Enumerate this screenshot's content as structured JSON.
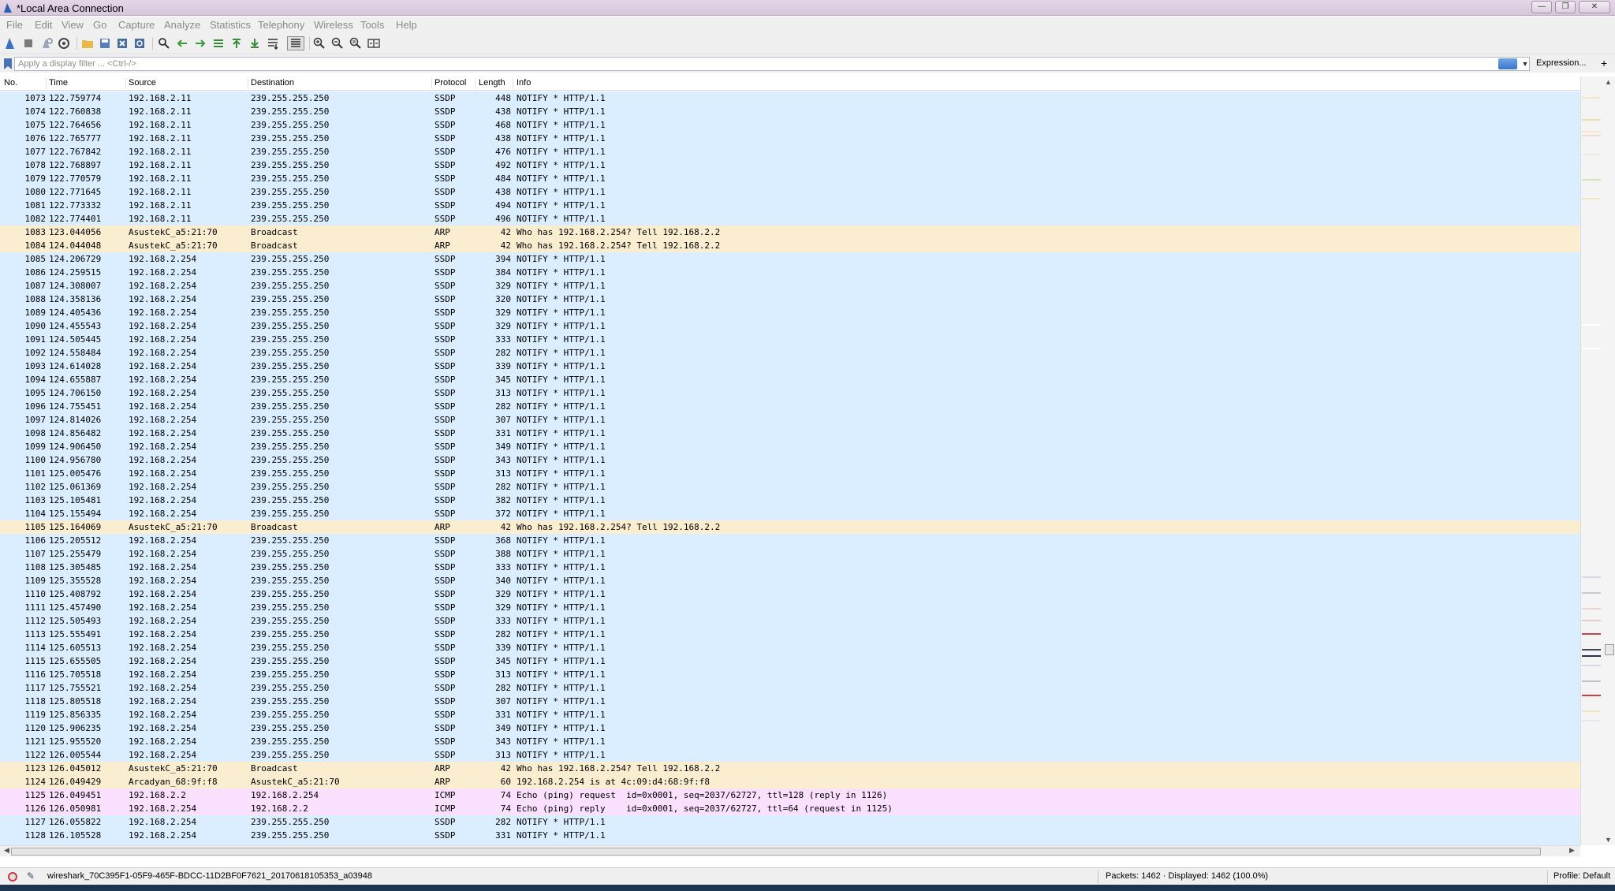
{
  "window": {
    "title": "*Local Area Connection"
  },
  "menu": [
    "File",
    "Edit",
    "View",
    "Go",
    "Capture",
    "Analyze",
    "Statistics",
    "Telephony",
    "Wireless",
    "Tools",
    "Help"
  ],
  "filter": {
    "placeholder": "Apply a display filter ... <Ctrl-/>",
    "expression_label": "Expression...",
    "add_label": "+"
  },
  "columns": {
    "no": "No.",
    "time": "Time",
    "source": "Source",
    "destination": "Destination",
    "protocol": "Protocol",
    "length": "Length",
    "info": "Info"
  },
  "packets": [
    {
      "no": "1073",
      "time": "122.759774",
      "src": "192.168.2.11",
      "dst": "239.255.255.250",
      "proto": "SSDP",
      "len": "448",
      "info": "NOTIFY * HTTP/1.1"
    },
    {
      "no": "1074",
      "time": "122.760838",
      "src": "192.168.2.11",
      "dst": "239.255.255.250",
      "proto": "SSDP",
      "len": "438",
      "info": "NOTIFY * HTTP/1.1"
    },
    {
      "no": "1075",
      "time": "122.764656",
      "src": "192.168.2.11",
      "dst": "239.255.255.250",
      "proto": "SSDP",
      "len": "468",
      "info": "NOTIFY * HTTP/1.1"
    },
    {
      "no": "1076",
      "time": "122.765777",
      "src": "192.168.2.11",
      "dst": "239.255.255.250",
      "proto": "SSDP",
      "len": "438",
      "info": "NOTIFY * HTTP/1.1"
    },
    {
      "no": "1077",
      "time": "122.767842",
      "src": "192.168.2.11",
      "dst": "239.255.255.250",
      "proto": "SSDP",
      "len": "476",
      "info": "NOTIFY * HTTP/1.1"
    },
    {
      "no": "1078",
      "time": "122.768897",
      "src": "192.168.2.11",
      "dst": "239.255.255.250",
      "proto": "SSDP",
      "len": "492",
      "info": "NOTIFY * HTTP/1.1"
    },
    {
      "no": "1079",
      "time": "122.770579",
      "src": "192.168.2.11",
      "dst": "239.255.255.250",
      "proto": "SSDP",
      "len": "484",
      "info": "NOTIFY * HTTP/1.1"
    },
    {
      "no": "1080",
      "time": "122.771645",
      "src": "192.168.2.11",
      "dst": "239.255.255.250",
      "proto": "SSDP",
      "len": "438",
      "info": "NOTIFY * HTTP/1.1"
    },
    {
      "no": "1081",
      "time": "122.773332",
      "src": "192.168.2.11",
      "dst": "239.255.255.250",
      "proto": "SSDP",
      "len": "494",
      "info": "NOTIFY * HTTP/1.1"
    },
    {
      "no": "1082",
      "time": "122.774401",
      "src": "192.168.2.11",
      "dst": "239.255.255.250",
      "proto": "SSDP",
      "len": "496",
      "info": "NOTIFY * HTTP/1.1"
    },
    {
      "no": "1083",
      "time": "123.044056",
      "src": "AsustekC_a5:21:70",
      "dst": "Broadcast",
      "proto": "ARP",
      "len": "42",
      "info": "Who has 192.168.2.254? Tell 192.168.2.2"
    },
    {
      "no": "1084",
      "time": "124.044048",
      "src": "AsustekC_a5:21:70",
      "dst": "Broadcast",
      "proto": "ARP",
      "len": "42",
      "info": "Who has 192.168.2.254? Tell 192.168.2.2"
    },
    {
      "no": "1085",
      "time": "124.206729",
      "src": "192.168.2.254",
      "dst": "239.255.255.250",
      "proto": "SSDP",
      "len": "394",
      "info": "NOTIFY * HTTP/1.1"
    },
    {
      "no": "1086",
      "time": "124.259515",
      "src": "192.168.2.254",
      "dst": "239.255.255.250",
      "proto": "SSDP",
      "len": "384",
      "info": "NOTIFY * HTTP/1.1"
    },
    {
      "no": "1087",
      "time": "124.308007",
      "src": "192.168.2.254",
      "dst": "239.255.255.250",
      "proto": "SSDP",
      "len": "329",
      "info": "NOTIFY * HTTP/1.1"
    },
    {
      "no": "1088",
      "time": "124.358136",
      "src": "192.168.2.254",
      "dst": "239.255.255.250",
      "proto": "SSDP",
      "len": "320",
      "info": "NOTIFY * HTTP/1.1"
    },
    {
      "no": "1089",
      "time": "124.405436",
      "src": "192.168.2.254",
      "dst": "239.255.255.250",
      "proto": "SSDP",
      "len": "329",
      "info": "NOTIFY * HTTP/1.1"
    },
    {
      "no": "1090",
      "time": "124.455543",
      "src": "192.168.2.254",
      "dst": "239.255.255.250",
      "proto": "SSDP",
      "len": "329",
      "info": "NOTIFY * HTTP/1.1"
    },
    {
      "no": "1091",
      "time": "124.505445",
      "src": "192.168.2.254",
      "dst": "239.255.255.250",
      "proto": "SSDP",
      "len": "333",
      "info": "NOTIFY * HTTP/1.1"
    },
    {
      "no": "1092",
      "time": "124.558484",
      "src": "192.168.2.254",
      "dst": "239.255.255.250",
      "proto": "SSDP",
      "len": "282",
      "info": "NOTIFY * HTTP/1.1"
    },
    {
      "no": "1093",
      "time": "124.614028",
      "src": "192.168.2.254",
      "dst": "239.255.255.250",
      "proto": "SSDP",
      "len": "339",
      "info": "NOTIFY * HTTP/1.1"
    },
    {
      "no": "1094",
      "time": "124.655887",
      "src": "192.168.2.254",
      "dst": "239.255.255.250",
      "proto": "SSDP",
      "len": "345",
      "info": "NOTIFY * HTTP/1.1"
    },
    {
      "no": "1095",
      "time": "124.706150",
      "src": "192.168.2.254",
      "dst": "239.255.255.250",
      "proto": "SSDP",
      "len": "313",
      "info": "NOTIFY * HTTP/1.1"
    },
    {
      "no": "1096",
      "time": "124.755451",
      "src": "192.168.2.254",
      "dst": "239.255.255.250",
      "proto": "SSDP",
      "len": "282",
      "info": "NOTIFY * HTTP/1.1"
    },
    {
      "no": "1097",
      "time": "124.814026",
      "src": "192.168.2.254",
      "dst": "239.255.255.250",
      "proto": "SSDP",
      "len": "307",
      "info": "NOTIFY * HTTP/1.1"
    },
    {
      "no": "1098",
      "time": "124.856482",
      "src": "192.168.2.254",
      "dst": "239.255.255.250",
      "proto": "SSDP",
      "len": "331",
      "info": "NOTIFY * HTTP/1.1"
    },
    {
      "no": "1099",
      "time": "124.906450",
      "src": "192.168.2.254",
      "dst": "239.255.255.250",
      "proto": "SSDP",
      "len": "349",
      "info": "NOTIFY * HTTP/1.1"
    },
    {
      "no": "1100",
      "time": "124.956780",
      "src": "192.168.2.254",
      "dst": "239.255.255.250",
      "proto": "SSDP",
      "len": "343",
      "info": "NOTIFY * HTTP/1.1"
    },
    {
      "no": "1101",
      "time": "125.005476",
      "src": "192.168.2.254",
      "dst": "239.255.255.250",
      "proto": "SSDP",
      "len": "313",
      "info": "NOTIFY * HTTP/1.1"
    },
    {
      "no": "1102",
      "time": "125.061369",
      "src": "192.168.2.254",
      "dst": "239.255.255.250",
      "proto": "SSDP",
      "len": "282",
      "info": "NOTIFY * HTTP/1.1"
    },
    {
      "no": "1103",
      "time": "125.105481",
      "src": "192.168.2.254",
      "dst": "239.255.255.250",
      "proto": "SSDP",
      "len": "382",
      "info": "NOTIFY * HTTP/1.1"
    },
    {
      "no": "1104",
      "time": "125.155494",
      "src": "192.168.2.254",
      "dst": "239.255.255.250",
      "proto": "SSDP",
      "len": "372",
      "info": "NOTIFY * HTTP/1.1"
    },
    {
      "no": "1105",
      "time": "125.164069",
      "src": "AsustekC_a5:21:70",
      "dst": "Broadcast",
      "proto": "ARP",
      "len": "42",
      "info": "Who has 192.168.2.254? Tell 192.168.2.2"
    },
    {
      "no": "1106",
      "time": "125.205512",
      "src": "192.168.2.254",
      "dst": "239.255.255.250",
      "proto": "SSDP",
      "len": "368",
      "info": "NOTIFY * HTTP/1.1"
    },
    {
      "no": "1107",
      "time": "125.255479",
      "src": "192.168.2.254",
      "dst": "239.255.255.250",
      "proto": "SSDP",
      "len": "388",
      "info": "NOTIFY * HTTP/1.1"
    },
    {
      "no": "1108",
      "time": "125.305485",
      "src": "192.168.2.254",
      "dst": "239.255.255.250",
      "proto": "SSDP",
      "len": "333",
      "info": "NOTIFY * HTTP/1.1"
    },
    {
      "no": "1109",
      "time": "125.355528",
      "src": "192.168.2.254",
      "dst": "239.255.255.250",
      "proto": "SSDP",
      "len": "340",
      "info": "NOTIFY * HTTP/1.1"
    },
    {
      "no": "1110",
      "time": "125.408792",
      "src": "192.168.2.254",
      "dst": "239.255.255.250",
      "proto": "SSDP",
      "len": "329",
      "info": "NOTIFY * HTTP/1.1"
    },
    {
      "no": "1111",
      "time": "125.457490",
      "src": "192.168.2.254",
      "dst": "239.255.255.250",
      "proto": "SSDP",
      "len": "329",
      "info": "NOTIFY * HTTP/1.1"
    },
    {
      "no": "1112",
      "time": "125.505493",
      "src": "192.168.2.254",
      "dst": "239.255.255.250",
      "proto": "SSDP",
      "len": "333",
      "info": "NOTIFY * HTTP/1.1"
    },
    {
      "no": "1113",
      "time": "125.555491",
      "src": "192.168.2.254",
      "dst": "239.255.255.250",
      "proto": "SSDP",
      "len": "282",
      "info": "NOTIFY * HTTP/1.1"
    },
    {
      "no": "1114",
      "time": "125.605513",
      "src": "192.168.2.254",
      "dst": "239.255.255.250",
      "proto": "SSDP",
      "len": "339",
      "info": "NOTIFY * HTTP/1.1"
    },
    {
      "no": "1115",
      "time": "125.655505",
      "src": "192.168.2.254",
      "dst": "239.255.255.250",
      "proto": "SSDP",
      "len": "345",
      "info": "NOTIFY * HTTP/1.1"
    },
    {
      "no": "1116",
      "time": "125.705518",
      "src": "192.168.2.254",
      "dst": "239.255.255.250",
      "proto": "SSDP",
      "len": "313",
      "info": "NOTIFY * HTTP/1.1"
    },
    {
      "no": "1117",
      "time": "125.755521",
      "src": "192.168.2.254",
      "dst": "239.255.255.250",
      "proto": "SSDP",
      "len": "282",
      "info": "NOTIFY * HTTP/1.1"
    },
    {
      "no": "1118",
      "time": "125.805518",
      "src": "192.168.2.254",
      "dst": "239.255.255.250",
      "proto": "SSDP",
      "len": "307",
      "info": "NOTIFY * HTTP/1.1"
    },
    {
      "no": "1119",
      "time": "125.856335",
      "src": "192.168.2.254",
      "dst": "239.255.255.250",
      "proto": "SSDP",
      "len": "331",
      "info": "NOTIFY * HTTP/1.1"
    },
    {
      "no": "1120",
      "time": "125.906235",
      "src": "192.168.2.254",
      "dst": "239.255.255.250",
      "proto": "SSDP",
      "len": "349",
      "info": "NOTIFY * HTTP/1.1"
    },
    {
      "no": "1121",
      "time": "125.955520",
      "src": "192.168.2.254",
      "dst": "239.255.255.250",
      "proto": "SSDP",
      "len": "343",
      "info": "NOTIFY * HTTP/1.1"
    },
    {
      "no": "1122",
      "time": "126.005544",
      "src": "192.168.2.254",
      "dst": "239.255.255.250",
      "proto": "SSDP",
      "len": "313",
      "info": "NOTIFY * HTTP/1.1"
    },
    {
      "no": "1123",
      "time": "126.045012",
      "src": "AsustekC_a5:21:70",
      "dst": "Broadcast",
      "proto": "ARP",
      "len": "42",
      "info": "Who has 192.168.2.254? Tell 192.168.2.2"
    },
    {
      "no": "1124",
      "time": "126.049429",
      "src": "Arcadyan_68:9f:f8",
      "dst": "AsustekC_a5:21:70",
      "proto": "ARP",
      "len": "60",
      "info": "192.168.2.254 is at 4c:09:d4:68:9f:f8"
    },
    {
      "no": "1125",
      "time": "126.049451",
      "src": "192.168.2.2",
      "dst": "192.168.2.254",
      "proto": "ICMP",
      "len": "74",
      "info": "Echo (ping) request  id=0x0001, seq=2037/62727, ttl=128 (reply in 1126)"
    },
    {
      "no": "1126",
      "time": "126.050981",
      "src": "192.168.2.254",
      "dst": "192.168.2.2",
      "proto": "ICMP",
      "len": "74",
      "info": "Echo (ping) reply    id=0x0001, seq=2037/62727, ttl=64 (request in 1125)"
    },
    {
      "no": "1127",
      "time": "126.055822",
      "src": "192.168.2.254",
      "dst": "239.255.255.250",
      "proto": "SSDP",
      "len": "282",
      "info": "NOTIFY * HTTP/1.1"
    },
    {
      "no": "1128",
      "time": "126.105528",
      "src": "192.168.2.254",
      "dst": "239.255.255.250",
      "proto": "SSDP",
      "len": "331",
      "info": "NOTIFY * HTTP/1.1"
    }
  ],
  "protocol_colors": {
    "SSDP": "#daeeff",
    "ARP": "#fbedd0",
    "ICMP": "#fce0ff"
  },
  "status": {
    "file": "wireshark_70C395F1-05F9-465F-BDCC-11D2BF0F7621_20170618105353_a03948",
    "packets": "Packets: 1462 · Displayed: 1462 (100.0%)",
    "profile": "Profile: Default"
  }
}
